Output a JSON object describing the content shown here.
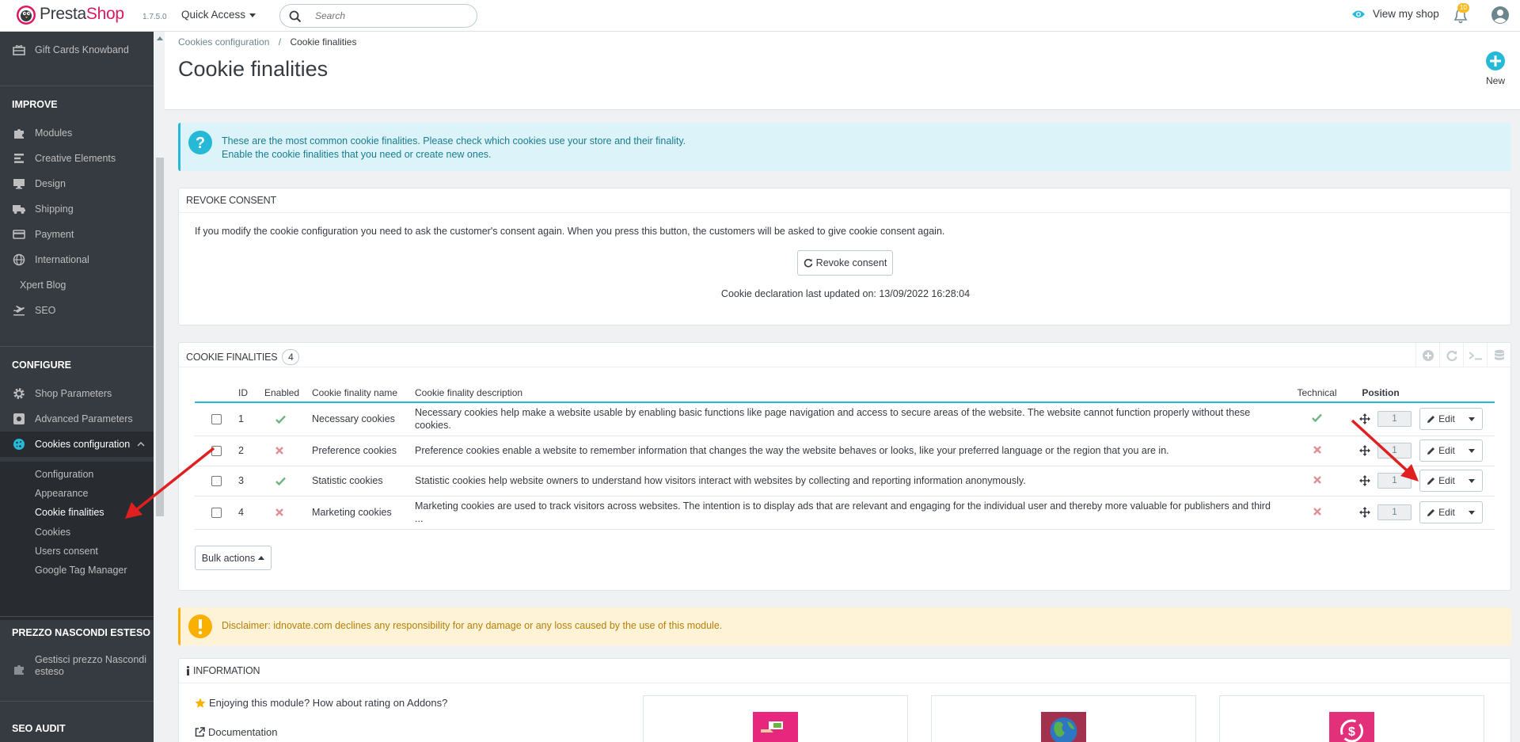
{
  "header": {
    "brand_prefix": "Presta",
    "brand_suffix": "Shop",
    "version": "1.7.5.0",
    "quick_access": "Quick Access",
    "search_placeholder": "Search",
    "view_shop": "View my shop",
    "notifications_count": "10",
    "accent": "#25b9d7",
    "brand_color": "#dc1960"
  },
  "sidebar": {
    "top_item": "Gift Cards Knowband",
    "sections": {
      "improve": "IMPROVE",
      "configure": "CONFIGURE",
      "prezzo": "PREZZO NASCONDI ESTESO",
      "seo": "SEO AUDIT"
    },
    "improve_items": [
      "Modules",
      "Creative Elements",
      "Design",
      "Shipping",
      "Payment",
      "International",
      "Xpert Blog",
      "SEO"
    ],
    "configure_items": [
      "Shop Parameters",
      "Advanced Parameters",
      "Cookies configuration"
    ],
    "cookies_sub": [
      "Configuration",
      "Appearance",
      "Cookie finalities",
      "Cookies",
      "Users consent",
      "Google Tag Manager"
    ],
    "prezzo_item": "Gestisci prezzo Nascondi esteso"
  },
  "page": {
    "breadcrumb_parent": "Cookies configuration",
    "breadcrumb_sep": "/",
    "breadcrumb_current": "Cookie finalities",
    "title": "Cookie finalities",
    "new_label": "New"
  },
  "info_alert": {
    "line1": "These are the most common cookie finalities. Please check which cookies use your store and their finality.",
    "line2": "Enable the cookie finalities that you need or create new ones."
  },
  "revoke": {
    "heading": "REVOKE CONSENT",
    "text": "If you modify the cookie configuration you need to ask the customer's consent again. When you press this button, the customers will be asked to give cookie consent again.",
    "button": "Revoke consent",
    "last_updated": "Cookie declaration last updated on: 13/09/2022 16:28:04"
  },
  "finalities": {
    "heading": "COOKIE FINALITIES",
    "count": "4",
    "columns": {
      "id": "ID",
      "enabled": "Enabled",
      "name": "Cookie finality name",
      "description": "Cookie finality description",
      "technical": "Technical",
      "position": "Position"
    },
    "rows": [
      {
        "id": "1",
        "enabled": true,
        "name": "Necessary cookies",
        "description": "Necessary cookies help make a website usable by enabling basic functions like page navigation and access to secure areas of the website. The website cannot function properly without these cookies.",
        "technical": true,
        "position": "1"
      },
      {
        "id": "2",
        "enabled": false,
        "name": "Preference cookies",
        "description": "Preference cookies enable a website to remember information that changes the way the website behaves or looks, like your preferred language or the region that you are in.",
        "technical": false,
        "position": "1"
      },
      {
        "id": "3",
        "enabled": true,
        "name": "Statistic cookies",
        "description": "Statistic cookies help website owners to understand how visitors interact with websites by collecting and reporting information anonymously.",
        "technical": false,
        "position": "1"
      },
      {
        "id": "4",
        "enabled": false,
        "name": "Marketing cookies",
        "description": "Marketing cookies are used to track visitors across websites. The intention is to display ads that are relevant and engaging for the individual user and thereby more valuable for publishers and third ...",
        "technical": false,
        "position": "1"
      }
    ],
    "edit_label": "Edit",
    "bulk_actions": "Bulk actions"
  },
  "disclaimer": "Disclaimer: idnovate.com declines any responsibility for any damage or any loss caused by the use of this module.",
  "information": {
    "heading": "INFORMATION",
    "rating": "Enjoying this module? How about rating on Addons?",
    "documentation": "Documentation"
  }
}
